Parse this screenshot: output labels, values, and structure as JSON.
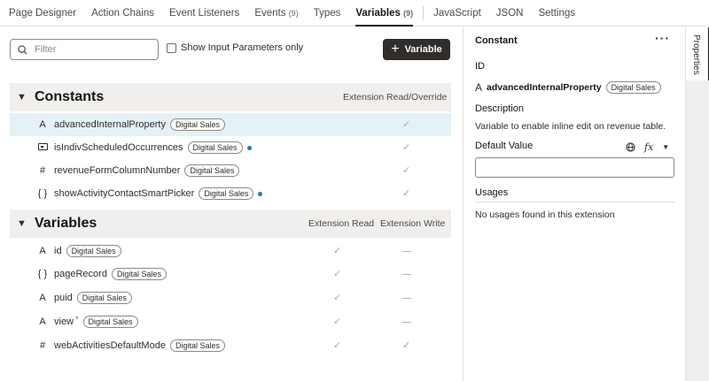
{
  "tabs": [
    {
      "label": "Page Designer"
    },
    {
      "label": "Action Chains"
    },
    {
      "label": "Event Listeners"
    },
    {
      "label": "Events",
      "count": "(9)"
    },
    {
      "label": "Types"
    },
    {
      "label": "Variables",
      "count": "(9)",
      "active": true
    },
    {
      "label": "JavaScript"
    },
    {
      "label": "JSON"
    },
    {
      "label": "Settings"
    }
  ],
  "toolbar": {
    "filter_placeholder": "Filter",
    "show_input_label": "Show Input Parameters only",
    "add_variable_label": "Variable"
  },
  "constants": {
    "title": "Constants",
    "column": "Extension Read/Override",
    "items": [
      {
        "icon": "string-icon",
        "name": "advancedInternalProperty",
        "badge": "Digital Sales",
        "dot": false,
        "selected": true
      },
      {
        "icon": "boolean-icon",
        "name": "isIndivScheduledOccurrences",
        "badge": "Digital Sales",
        "dot": true
      },
      {
        "icon": "number-icon",
        "name": "revenueFormColumnNumber",
        "badge": "Digital Sales",
        "dot": false
      },
      {
        "icon": "object-icon",
        "name": "showActivityContactSmartPicker",
        "badge": "Digital Sales",
        "dot": true
      }
    ]
  },
  "variables": {
    "title": "Variables",
    "col_read": "Extension Read",
    "col_write": "Extension Write",
    "items": [
      {
        "icon": "string-icon",
        "name": "id",
        "badge": "Digital Sales",
        "write": "dash"
      },
      {
        "icon": "object-icon",
        "name": "pageRecord",
        "badge": "Digital Sales",
        "write": "dash"
      },
      {
        "icon": "string-icon",
        "name": "puid",
        "badge": "Digital Sales",
        "write": "dash"
      },
      {
        "icon": "string-icon",
        "name": "view",
        "badge": "Digital Sales",
        "star": "*",
        "write": "dash"
      },
      {
        "icon": "number-icon",
        "name": "webActivitiesDefaultMode",
        "badge": "Digital Sales",
        "write": "check"
      }
    ]
  },
  "properties": {
    "header": "Constant",
    "more": "···",
    "id_label": "ID",
    "id_value": "advancedInternalProperty",
    "id_badge": "Digital Sales",
    "description_label": "Description",
    "description_value": "Variable to enable inline edit on revenue table.",
    "default_label": "Default Value",
    "fx": "fx",
    "usages_label": "Usages",
    "usages_value": "No usages found in this extension"
  },
  "side_tab": "Properties",
  "colors": {
    "accent": "#227e9e",
    "dark": "#312d2a",
    "selected_row": "#e4f1f7"
  }
}
